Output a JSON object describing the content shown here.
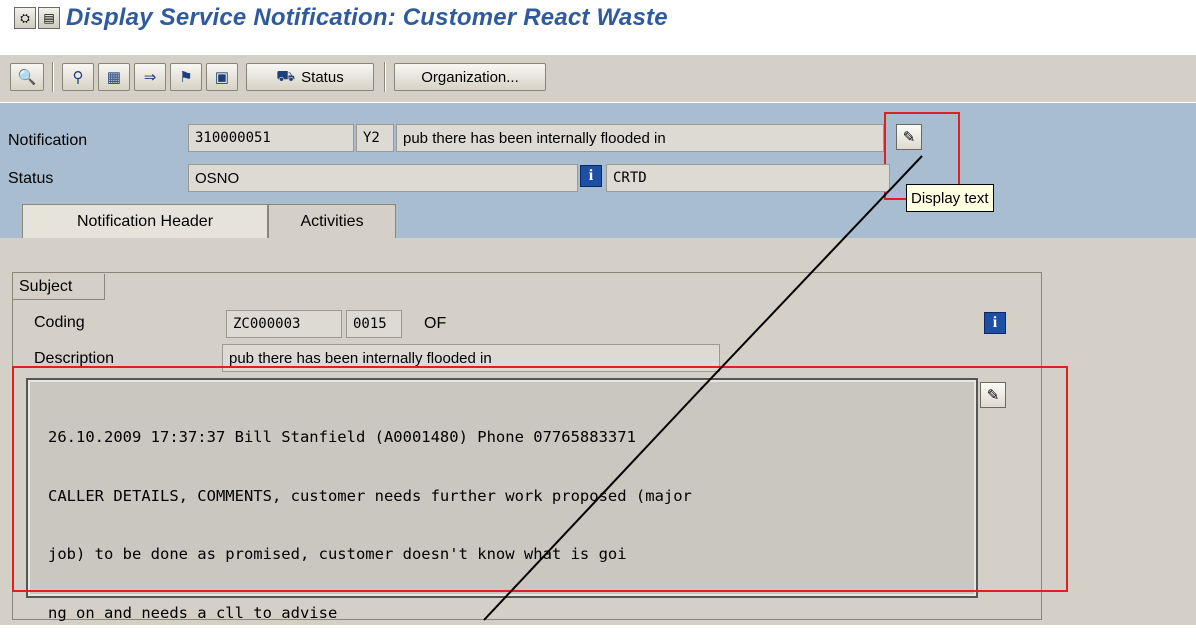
{
  "window": {
    "title": "Display Service Notification: Customer React Waste"
  },
  "title_icons": [
    "sap-icon",
    "menu-icon"
  ],
  "toolbar": {
    "status_label": "Status",
    "organization_label": "Organization..."
  },
  "header": {
    "notification_label": "Notification",
    "notification_number": "310000051",
    "notification_type": "Y2",
    "notification_short_text": "pub there has been internally flooded in",
    "status_label": "Status",
    "status_value": "OSNO",
    "system_status": "CRTD",
    "display_text_tooltip": "Display text"
  },
  "tabs": [
    {
      "label": "Notification Header",
      "active": true
    },
    {
      "label": "Activities",
      "active": false
    }
  ],
  "subject": {
    "group_label": "Subject",
    "coding_label": "Coding",
    "coding_group": "ZC000003",
    "coding_code": "0015",
    "coding_text": "OF",
    "description_label": "Description",
    "description_value": "pub there has been internally flooded in",
    "long_text": [
      "26.10.2009 17:37:37 Bill Stanfield (A0001480) Phone 07765883371",
      "CALLER DETAILS, COMMENTS, customer needs further work proposed (major",
      "job) to be done as promised, customer doesn't know what is goi",
      "ng on and needs a cll to advise"
    ]
  },
  "colors": {
    "title": "#2f5a9e",
    "header_bg": "#a8bdd0",
    "panel_bg": "#d4d0c8",
    "highlight": "#e02020"
  }
}
